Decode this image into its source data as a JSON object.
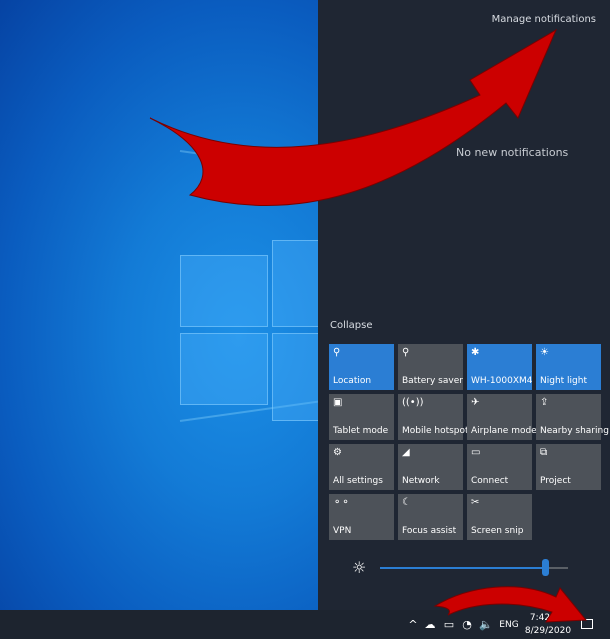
{
  "action_center": {
    "manage_notifications": "Manage notifications",
    "no_new_notifications": "No new notifications",
    "collapse": "Collapse"
  },
  "quick_actions": [
    {
      "label": "Location",
      "icon": "⚲",
      "on": true
    },
    {
      "label": "Battery saver",
      "icon": "⚲",
      "on": false
    },
    {
      "label": "WH-1000XM4",
      "icon": "✱",
      "on": true
    },
    {
      "label": "Night light",
      "icon": "☀",
      "on": true
    },
    {
      "label": "Tablet mode",
      "icon": "▣",
      "on": false
    },
    {
      "label": "Mobile hotspot",
      "icon": "((•))",
      "on": false
    },
    {
      "label": "Airplane mode",
      "icon": "✈",
      "on": false
    },
    {
      "label": "Nearby sharing",
      "icon": "⇪",
      "on": false
    },
    {
      "label": "All settings",
      "icon": "⚙",
      "on": false
    },
    {
      "label": "Network",
      "icon": "◢",
      "on": false
    },
    {
      "label": "Connect",
      "icon": "▭",
      "on": false
    },
    {
      "label": "Project",
      "icon": "⧉",
      "on": false
    },
    {
      "label": "VPN",
      "icon": "⚬⚬",
      "on": false
    },
    {
      "label": "Focus assist",
      "icon": "☾",
      "on": false
    },
    {
      "label": "Screen snip",
      "icon": "✂",
      "on": false
    }
  ],
  "brightness": {
    "level": 0.88,
    "icon": "☼"
  },
  "taskbar": {
    "tray_icons": [
      "^",
      "☁",
      "▭",
      "◔",
      "🔈"
    ],
    "language": "ENG",
    "time": "7:42 PM",
    "date": "8/29/2020"
  },
  "colors": {
    "accent": "#2b7ed4",
    "arrow": "#cc0000"
  }
}
